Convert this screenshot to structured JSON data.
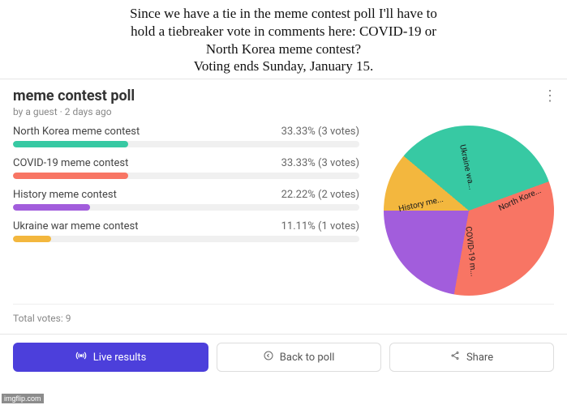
{
  "caption": "Since we have a tie in the meme contest poll I'll have to\nhold a tiebreaker vote in comments here: COVID-19 or\nNorth Korea meme contest?\nVoting ends Sunday, January 15.",
  "poll": {
    "title": "meme contest poll",
    "byline": "by a guest · 2 days ago",
    "menu_glyph": "⋮",
    "options": [
      {
        "label": "North Korea meme contest",
        "percent": 33.33,
        "votes": 3,
        "color": "#37c9a3",
        "short": "North Kore..."
      },
      {
        "label": "COVID-19 meme contest",
        "percent": 33.33,
        "votes": 3,
        "color": "#f87564",
        "short": "COVID-19 m..."
      },
      {
        "label": "History meme contest",
        "percent": 22.22,
        "votes": 2,
        "color": "#a25ddc",
        "short": "History me..."
      },
      {
        "label": "Ukraine war meme contest",
        "percent": 11.11,
        "votes": 1,
        "color": "#f3b73e",
        "short": "Ukraine wa..."
      }
    ],
    "total_label": "Total votes: 9"
  },
  "buttons": {
    "live": "Live results",
    "back": "Back to poll",
    "share": "Share"
  },
  "watermark": "imgflip.com",
  "chart_data": {
    "type": "pie",
    "title": "meme contest poll",
    "series": [
      {
        "name": "North Korea meme contest",
        "value": 33.33,
        "votes": 3
      },
      {
        "name": "COVID-19 meme contest",
        "value": 33.33,
        "votes": 3
      },
      {
        "name": "History meme contest",
        "value": 22.22,
        "votes": 2
      },
      {
        "name": "Ukraine war meme contest",
        "value": 11.11,
        "votes": 1
      }
    ],
    "total": 9,
    "unit": "percent"
  }
}
